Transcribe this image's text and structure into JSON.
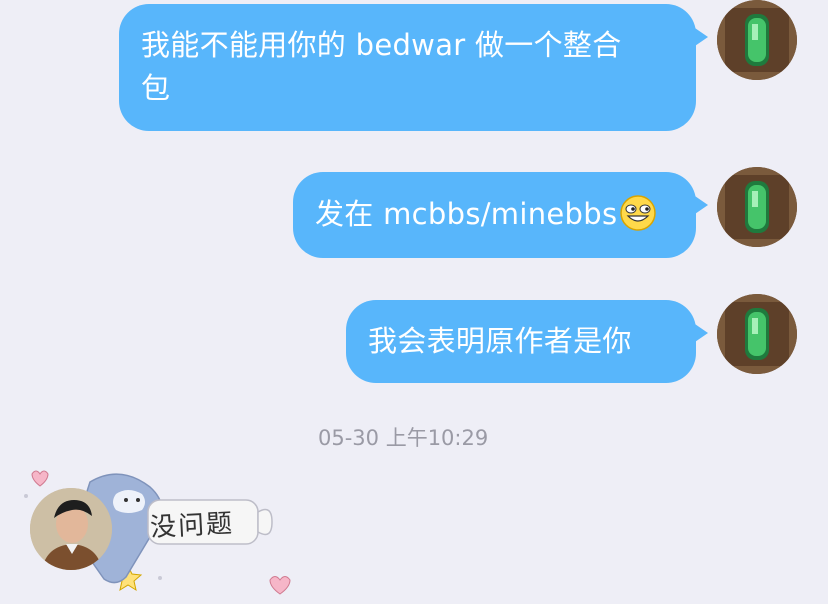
{
  "messages": [
    {
      "text": "我能不能用你的 bedwar 做一个整合包",
      "line1": "我能不能用你的 bedwar 做一个整合",
      "line2": "包"
    },
    {
      "text": "发在 mcbbs/minebbs",
      "emoji": "grinning-face"
    },
    {
      "text": "我会表明原作者是你"
    }
  ],
  "timestamp": "05-30 上午10:29",
  "reply_sticker": {
    "text": "没问题"
  },
  "colors": {
    "bubble": "#58b6fb",
    "background": "#eeeef6",
    "emerald": "#3cb371"
  }
}
